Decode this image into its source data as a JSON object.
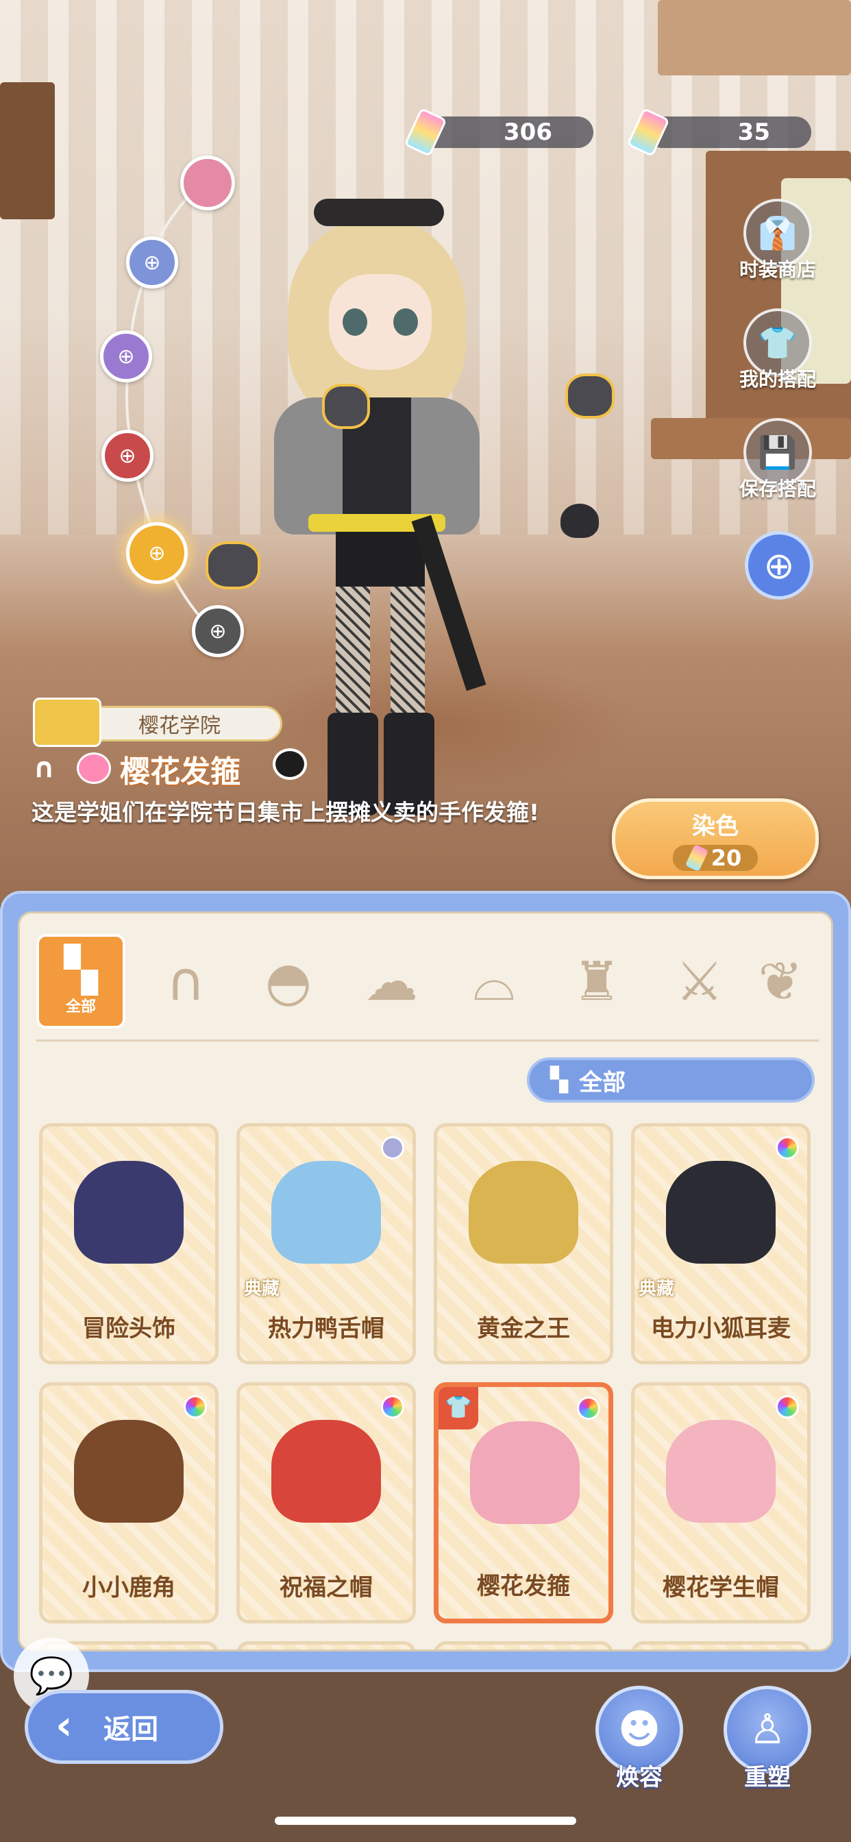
{
  "currency": {
    "primary_amount": "306",
    "secondary_amount": "35"
  },
  "side_menu": {
    "shop_label": "时装商店",
    "outfits_label": "我的搭配",
    "save_label": "保存搭配"
  },
  "item": {
    "set_name": "樱花学院",
    "name": "樱花发箍",
    "description": "这是学姐们在学院节日集市上摆摊义卖的手作发箍!"
  },
  "dye": {
    "label": "染色",
    "cost": "20"
  },
  "categories": {
    "all_label": "全部",
    "icons": [
      "cat-ears-icon",
      "mask-icon",
      "hair-icon",
      "eye-mask-icon",
      "top-icon",
      "sword-icon",
      "leaf-icon"
    ]
  },
  "filter": {
    "label": "全部"
  },
  "items": [
    {
      "label": "冒险头饰",
      "badge": "",
      "dot": "none",
      "selected": false
    },
    {
      "label": "热力鸭舌帽",
      "badge": "典藏",
      "dot": "gray",
      "selected": false
    },
    {
      "label": "黄金之王",
      "badge": "",
      "dot": "none",
      "selected": false
    },
    {
      "label": "电力小狐耳麦",
      "badge": "典藏",
      "dot": "rainbow",
      "selected": false
    },
    {
      "label": "小小鹿角",
      "badge": "",
      "dot": "rainbow",
      "selected": false
    },
    {
      "label": "祝福之帽",
      "badge": "",
      "dot": "rainbow",
      "selected": false
    },
    {
      "label": "樱花发箍",
      "badge": "",
      "dot": "rainbow",
      "selected": true
    },
    {
      "label": "樱花学生帽",
      "badge": "",
      "dot": "rainbow",
      "selected": false
    }
  ],
  "bottom": {
    "back_label": "返回",
    "makeover_label": "焕容",
    "reshape_label": "重塑"
  },
  "colors": {
    "accent": "#f29a3c",
    "panel_blue": "#8fb0ec",
    "selected_border": "#f07a45"
  }
}
